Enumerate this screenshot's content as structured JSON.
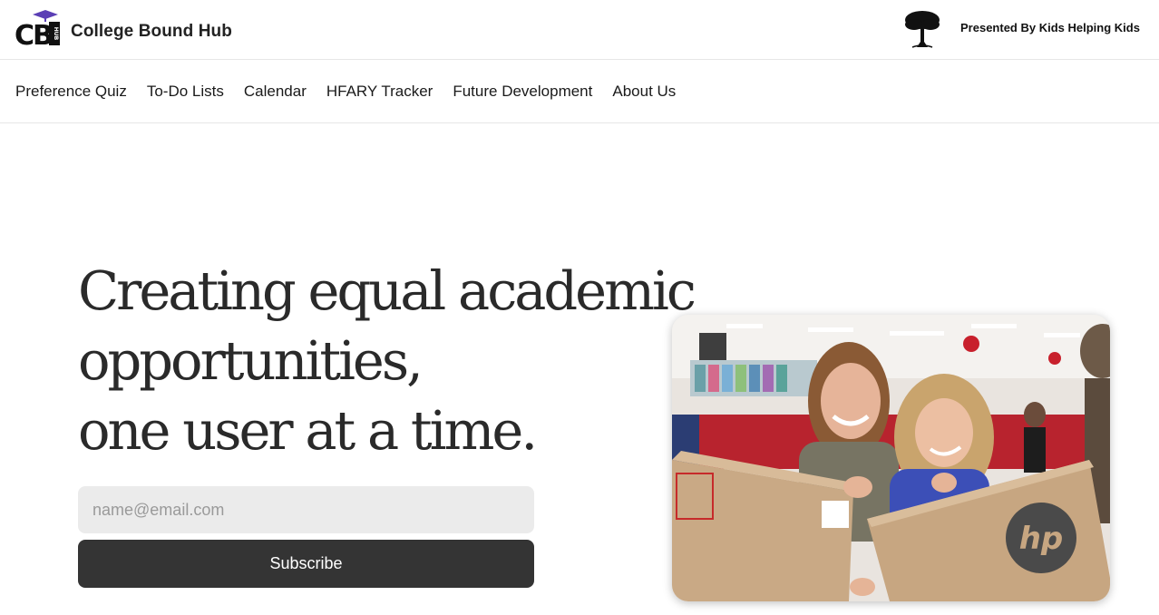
{
  "header": {
    "brand": "College Bound Hub",
    "logo_text": "CBHub",
    "presented_by": "Presented By Kids Helping Kids"
  },
  "nav": {
    "items": [
      {
        "label": "Preference Quiz"
      },
      {
        "label": "To-Do Lists"
      },
      {
        "label": "Calendar"
      },
      {
        "label": "HFARY Tracker"
      },
      {
        "label": "Future Development"
      },
      {
        "label": "About Us"
      }
    ]
  },
  "hero": {
    "headline_lines": [
      "Creating equal academic",
      "opportunities,",
      "one user at a time."
    ],
    "email_placeholder": "name@email.com",
    "subscribe_label": "Subscribe"
  },
  "photo": {
    "description_icon": "photo-two-students-with-laptop-boxes",
    "box_brand": "hp"
  },
  "colors": {
    "button_bg": "#343434",
    "input_bg": "#ebebeb",
    "logo_cap": "#5b3fb5",
    "text": "#1a1a1a"
  }
}
